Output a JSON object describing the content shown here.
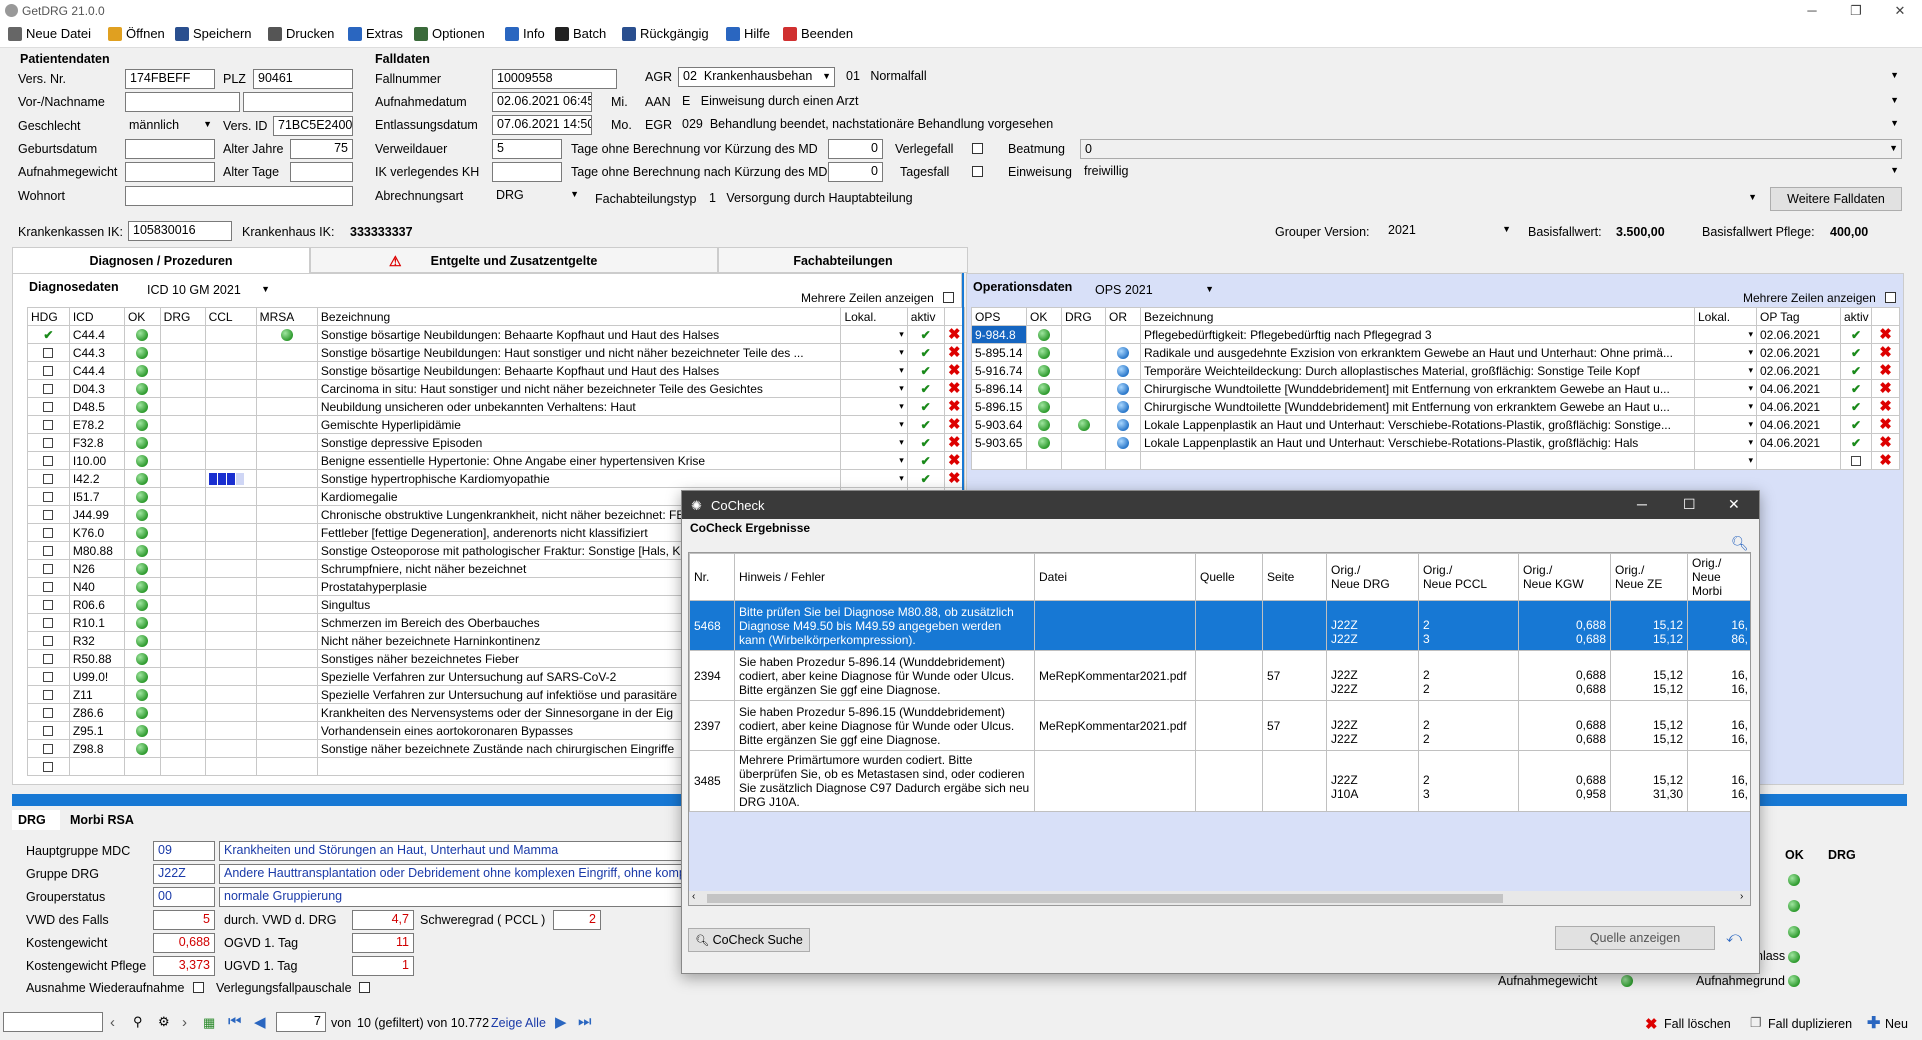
{
  "app": {
    "title": "GetDRG 21.0.0"
  },
  "menu": [
    {
      "label": "Neue Datei",
      "icon": "new-file-icon",
      "color": "#666666"
    },
    {
      "label": "Öffnen",
      "icon": "folder-open-icon",
      "color": "#e0a020"
    },
    {
      "label": "Speichern",
      "icon": "save-icon",
      "color": "#2a4f8f"
    },
    {
      "label": "Drucken",
      "icon": "print-icon",
      "color": "#555555"
    },
    {
      "label": "Extras",
      "icon": "tools-icon",
      "color": "#2a66c0"
    },
    {
      "label": "Optionen",
      "icon": "options-icon",
      "color": "#3a6a3a"
    },
    {
      "label": "Info",
      "icon": "info-icon",
      "color": "#2a66c0"
    },
    {
      "label": "Batch",
      "icon": "batch-icon",
      "color": "#222222"
    },
    {
      "label": "Rückgängig",
      "icon": "undo-icon",
      "color": "#2a4f8f"
    },
    {
      "label": "Hilfe",
      "icon": "help-icon",
      "color": "#2a66c0"
    },
    {
      "label": "Beenden",
      "icon": "exit-icon",
      "color": "#d03030"
    }
  ],
  "patient": {
    "section": "Patientendaten",
    "vers_nr_label": "Vers. Nr.",
    "vers_nr": "174FBEFF",
    "plz_label": "PLZ",
    "plz": "90461",
    "name_label": "Vor-/Nachname",
    "gender_label": "Geschlecht",
    "gender": "männlich",
    "vers_id_label": "Vers. ID",
    "vers_id": "71BC5E2400",
    "birth_label": "Geburtsdatum",
    "age_years_label": "Alter Jahre",
    "age_years": "75",
    "weight_label": "Aufnahmegewicht",
    "age_days_label": "Alter Tage",
    "residence_label": "Wohnort"
  },
  "case": {
    "section": "Falldaten",
    "fallnummer_label": "Fallnummer",
    "fallnummer": "10009558",
    "agr_label": "AGR",
    "agr_code": "02",
    "agr_text": "Krankenhausbehan",
    "agr2_code": "01",
    "agr2_text": "Normalfall",
    "aufnahme_label": "Aufnahmedatum",
    "aufnahme": "02.06.2021 06:45",
    "aufnahme_day": "Mi.",
    "aan_label": "AAN",
    "aan_code": "E",
    "aan_text": "Einweisung durch einen Arzt",
    "entlassung_label": "Entlassungsdatum",
    "entlassung": "07.06.2021 14:50",
    "entlassung_day": "Mo.",
    "egr_label": "EGR",
    "egr_code": "029",
    "egr_text": "Behandlung beendet, nachstationäre Behandlung vorgesehen",
    "verweildauer_label": "Verweildauer",
    "verweildauer": "5",
    "tage_vor_label": "Tage ohne Berechnung vor Kürzung des MD",
    "tage_vor": "0",
    "verlegefall_label": "Verlegefall",
    "beatmung_label": "Beatmung",
    "beatmung": "0",
    "ik_label": "IK verlegendes KH",
    "tage_nach_label": "Tage ohne Berechnung nach Kürzung des MD",
    "tage_nach": "0",
    "tagesfall_label": "Tagesfall",
    "einweisung_label": "Einweisung",
    "einweisung": "freiwillig",
    "abrechnung_label": "Abrechnungsart",
    "abrechnung": "DRG",
    "fachabt_label": "Fachabteilungstyp",
    "fachabt_code": "1",
    "fachabt_text": "Versorgung durch Hauptabteilung",
    "more_button": "Weitere Falldaten"
  },
  "insurance": {
    "kk_label": "Krankenkassen IK:",
    "kk": "105830016",
    "kh_label": "Krankenhaus IK:",
    "kh": "333333337",
    "grouper_label": "Grouper Version:",
    "grouper": "2021",
    "basis_label": "Basisfallwert:",
    "basis": "3.500,00",
    "pflege_label": "Basisfallwert Pflege:",
    "pflege": "400,00"
  },
  "tabs": [
    "Diagnosen / Prozeduren",
    "Entgelte und Zusatzentgelte",
    "Fachabteilungen"
  ],
  "diagnoses": {
    "title": "Diagnosedaten",
    "catalog": "ICD 10 GM 2021",
    "multi_label": "Mehrere Zeilen anzeigen",
    "headers": [
      "HDG",
      "ICD",
      "OK",
      "DRG",
      "CCL",
      "MRSA",
      "Bezeichnung",
      "Lokal.",
      "aktiv"
    ],
    "rows": [
      {
        "icd": "C44.4",
        "hdg": true,
        "drg": false,
        "ccl": 0,
        "mrsa": true,
        "text": "Sonstige bösartige Neubildungen: Behaarte Kopfhaut und Haut des Halses",
        "ctl": true
      },
      {
        "icd": "C44.3",
        "hdg": false,
        "drg": false,
        "ccl": 0,
        "mrsa": false,
        "text": "Sonstige bösartige Neubildungen: Haut sonstiger und nicht näher bezeichneter Teile des ...",
        "ctl": true
      },
      {
        "icd": "C44.4",
        "hdg": false,
        "drg": false,
        "ccl": 0,
        "mrsa": false,
        "text": "Sonstige bösartige Neubildungen: Behaarte Kopfhaut und Haut des Halses",
        "ctl": true
      },
      {
        "icd": "D04.3",
        "hdg": false,
        "drg": false,
        "ccl": 0,
        "mrsa": false,
        "text": "Carcinoma in situ: Haut sonstiger und nicht näher bezeichneter Teile des Gesichtes",
        "ctl": true
      },
      {
        "icd": "D48.5",
        "hdg": false,
        "drg": false,
        "ccl": 0,
        "mrsa": false,
        "text": "Neubildung unsicheren oder unbekannten Verhaltens: Haut",
        "ctl": true
      },
      {
        "icd": "E78.2",
        "hdg": false,
        "drg": false,
        "ccl": 0,
        "mrsa": false,
        "text": "Gemischte Hyperlipidämie",
        "ctl": true
      },
      {
        "icd": "F32.8",
        "hdg": false,
        "drg": false,
        "ccl": 0,
        "mrsa": false,
        "text": "Sonstige depressive Episoden",
        "ctl": true
      },
      {
        "icd": "I10.00",
        "hdg": false,
        "drg": false,
        "ccl": 0,
        "mrsa": false,
        "text": "Benigne essentielle Hypertonie: Ohne Angabe einer hypertensiven Krise",
        "ctl": true
      },
      {
        "icd": "I42.2",
        "hdg": false,
        "drg": false,
        "ccl": 3,
        "mrsa": false,
        "text": "Sonstige hypertrophische Kardiomyopathie",
        "ctl": true
      },
      {
        "icd": "I51.7",
        "hdg": false,
        "drg": false,
        "ccl": 0,
        "mrsa": false,
        "text": "Kardiomegalie",
        "ctl": false
      },
      {
        "icd": "J44.99",
        "hdg": false,
        "drg": false,
        "ccl": 0,
        "mrsa": false,
        "text": "Chronische obstruktive Lungenkrankheit, nicht näher bezeichnet: FE",
        "ctl": false
      },
      {
        "icd": "K76.0",
        "hdg": false,
        "drg": false,
        "ccl": 0,
        "mrsa": false,
        "text": "Fettleber [fettige Degeneration], anderenorts nicht klassifiziert",
        "ctl": false
      },
      {
        "icd": "M80.88",
        "hdg": false,
        "drg": false,
        "ccl": 0,
        "mrsa": false,
        "text": "Sonstige Osteoporose mit pathologischer Fraktur: Sonstige [Hals, K",
        "ctl": false
      },
      {
        "icd": "N26",
        "hdg": false,
        "drg": false,
        "ccl": 0,
        "mrsa": false,
        "text": "Schrumpfniere, nicht näher bezeichnet",
        "ctl": false
      },
      {
        "icd": "N40",
        "hdg": false,
        "drg": false,
        "ccl": 0,
        "mrsa": false,
        "text": "Prostatahyperplasie",
        "ctl": false
      },
      {
        "icd": "R06.6",
        "hdg": false,
        "drg": false,
        "ccl": 0,
        "mrsa": false,
        "text": "Singultus",
        "ctl": false
      },
      {
        "icd": "R10.1",
        "hdg": false,
        "drg": false,
        "ccl": 0,
        "mrsa": false,
        "text": "Schmerzen im Bereich des Oberbauches",
        "ctl": false
      },
      {
        "icd": "R32",
        "hdg": false,
        "drg": false,
        "ccl": 0,
        "mrsa": false,
        "text": "Nicht näher bezeichnete Harninkontinenz",
        "ctl": false
      },
      {
        "icd": "R50.88",
        "hdg": false,
        "drg": false,
        "ccl": 0,
        "mrsa": false,
        "text": "Sonstiges näher bezeichnetes Fieber",
        "ctl": false
      },
      {
        "icd": "U99.0!",
        "hdg": false,
        "drg": false,
        "ccl": 0,
        "mrsa": false,
        "text": "Spezielle Verfahren zur Untersuchung auf SARS-CoV-2",
        "ctl": false
      },
      {
        "icd": "Z11",
        "hdg": false,
        "drg": false,
        "ccl": 0,
        "mrsa": false,
        "text": "Spezielle Verfahren zur Untersuchung auf infektiöse und parasitäre",
        "ctl": false
      },
      {
        "icd": "Z86.6",
        "hdg": false,
        "drg": false,
        "ccl": 0,
        "mrsa": false,
        "text": "Krankheiten des Nervensystems oder der Sinnesorgane in der Eig",
        "ctl": false
      },
      {
        "icd": "Z95.1",
        "hdg": false,
        "drg": false,
        "ccl": 0,
        "mrsa": false,
        "text": "Vorhandensein eines aortokoronaren Bypasses",
        "ctl": false
      },
      {
        "icd": "Z98.8",
        "hdg": false,
        "drg": false,
        "ccl": 0,
        "mrsa": false,
        "text": "Sonstige näher bezeichnete Zustände nach chirurgischen Eingriffe",
        "ctl": false
      }
    ]
  },
  "operations": {
    "title": "Operationsdaten",
    "catalog": "OPS 2021",
    "multi_label": "Mehrere Zeilen anzeigen",
    "headers": [
      "OPS",
      "OK",
      "DRG",
      "OR",
      "Bezeichnung",
      "Lokal.",
      "OP Tag",
      "aktiv"
    ],
    "rows": [
      {
        "ops": "9-984.8",
        "drg": false,
        "or": false,
        "text": "Pflegebedürftigkeit: Pflegebedürftig nach Pflegegrad 3",
        "date": "02.06.2021",
        "selected": true
      },
      {
        "ops": "5-895.14",
        "drg": false,
        "or": true,
        "text": "Radikale und ausgedehnte Exzision von erkranktem Gewebe an Haut und Unterhaut: Ohne primä...",
        "date": "02.06.2021",
        "selected": false
      },
      {
        "ops": "5-916.74",
        "drg": false,
        "or": true,
        "text": "Temporäre Weichteildeckung: Durch alloplastisches Material, großflächig: Sonstige Teile Kopf",
        "date": "02.06.2021",
        "selected": false
      },
      {
        "ops": "5-896.14",
        "drg": false,
        "or": true,
        "text": "Chirurgische Wundtoilette [Wunddebridement] mit Entfernung von erkranktem Gewebe an Haut u...",
        "date": "04.06.2021",
        "selected": false
      },
      {
        "ops": "5-896.15",
        "drg": false,
        "or": true,
        "text": "Chirurgische Wundtoilette [Wunddebridement] mit Entfernung von erkranktem Gewebe an Haut u...",
        "date": "04.06.2021",
        "selected": false
      },
      {
        "ops": "5-903.64",
        "drg": true,
        "or": true,
        "text": "Lokale Lappenplastik an Haut und Unterhaut: Verschiebe-Rotations-Plastik, großflächig: Sonstige...",
        "date": "04.06.2021",
        "selected": false
      },
      {
        "ops": "5-903.65",
        "drg": false,
        "or": true,
        "text": "Lokale Lappenplastik an Haut und Unterhaut: Verschiebe-Rotations-Plastik, großflächig: Hals",
        "date": "04.06.2021",
        "selected": false
      }
    ]
  },
  "drg_panel": {
    "tabs": [
      "DRG",
      "Morbi RSA"
    ],
    "mdc_label": "Hauptgruppe MDC",
    "mdc": "09",
    "mdc_text": "Krankheiten und Störungen an Haut, Unterhaut und Mamma",
    "drg_label": "Gruppe DRG",
    "drg": "J22Z",
    "drg_text": "Andere Hauttransplantation oder Debridement ohne komplexen Eingriff, ohne kompl",
    "status_label": "Grouperstatus",
    "status": "00",
    "status_text": "normale Gruppierung",
    "vwd_label": "VWD des Falls",
    "vwd": "5",
    "dvwd_label": "durch. VWD d. DRG",
    "dvwd": "4,7",
    "pccl_label": "Schweregrad ( PCCL )",
    "pccl": "2",
    "kg_label": "Kostengewicht",
    "kg": "0,688",
    "ogvd_label": "OGVD 1. Tag",
    "ogvd": "11",
    "kgp_label": "Kostengewicht Pflege",
    "kgp": "3,373",
    "ugvd_label": "UGVD 1. Tag",
    "ugvd": "1",
    "wa_label": "Ausnahme Wiederaufnahme",
    "vfp_label": "Verlegungsfallpauschale"
  },
  "right_panel": {
    "ok_label": "OK",
    "drg_label": "DRG",
    "klass_label": "nlass",
    "weight_label": "Aufnahmegewicht",
    "grund_label": "Aufnahmegrund"
  },
  "nav": {
    "record": "7",
    "von_label": "von",
    "count": "10 (gefiltert) von 10.772",
    "show_all": "Zeige Alle",
    "delete": "Fall löschen",
    "duplicate": "Fall duplizieren",
    "new": "Neu"
  },
  "cocheck": {
    "window_title": "CoCheck",
    "heading": "CoCheck Ergebnisse",
    "headers": [
      "Nr.",
      "Hinweis / Fehler",
      "Datei",
      "Quelle",
      "Seite",
      "Orig./\nNeue DRG",
      "Orig./\nNeue PCCL",
      "Orig./\nNeue KGW",
      "Orig./\nNeue ZE",
      "Orig./\nNeue Morbi"
    ],
    "rows": [
      {
        "nr": "5468",
        "hint": "Bitte prüfen Sie bei Diagnose M80.88, ob zusätzlich Diagnose M49.50 bis M49.59 angegeben werden kann (Wirbelkörperkompression).",
        "file": "",
        "source": "",
        "page": "",
        "drg": [
          "J22Z",
          "J22Z"
        ],
        "pccl": [
          "2",
          "3"
        ],
        "kgw": [
          "0,688",
          "0,688"
        ],
        "ze": [
          "15,12",
          "15,12"
        ],
        "morbi": [
          "16,",
          "86,"
        ],
        "selected": true
      },
      {
        "nr": "2394",
        "hint": "Sie haben Prozedur 5-896.14 (Wunddebridement) codiert, aber keine Diagnose für Wunde oder Ulcus. Bitte ergänzen Sie ggf eine Diagnose.",
        "file": "MeRepKommentar2021.pdf",
        "source": "",
        "page": "57",
        "drg": [
          "J22Z",
          "J22Z"
        ],
        "pccl": [
          "2",
          "2"
        ],
        "kgw": [
          "0,688",
          "0,688"
        ],
        "ze": [
          "15,12",
          "15,12"
        ],
        "morbi": [
          "16,",
          "16,"
        ],
        "selected": false
      },
      {
        "nr": "2397",
        "hint": "Sie haben Prozedur 5-896.15 (Wunddebridement) codiert, aber keine Diagnose für Wunde oder Ulcus. Bitte ergänzen Sie ggf eine Diagnose.",
        "file": "MeRepKommentar2021.pdf",
        "source": "",
        "page": "57",
        "drg": [
          "J22Z",
          "J22Z"
        ],
        "pccl": [
          "2",
          "2"
        ],
        "kgw": [
          "0,688",
          "0,688"
        ],
        "ze": [
          "15,12",
          "15,12"
        ],
        "morbi": [
          "16,",
          "16,"
        ],
        "selected": false
      },
      {
        "nr": "3485",
        "hint": "Mehrere Primärtumore wurden codiert. Bitte überprüfen Sie, ob es Metastasen sind, oder codieren Sie zusätzlich Diagnose C97 Dadurch ergäbe sich neu DRG J10A.",
        "file": "",
        "source": "",
        "page": "",
        "drg": [
          "J22Z",
          "J10A"
        ],
        "pccl": [
          "2",
          "3"
        ],
        "kgw": [
          "0,688",
          "0,958"
        ],
        "ze": [
          "15,12",
          "31,30"
        ],
        "morbi": [
          "16,",
          "16,"
        ],
        "selected": false
      }
    ],
    "search_button": "CoCheck Suche",
    "source_button": "Quelle anzeigen"
  },
  "colors": {
    "accent": "#1778d4",
    "selection": "#1565c0",
    "panel_bg": "#d8e0f8",
    "error": "#d00000"
  }
}
